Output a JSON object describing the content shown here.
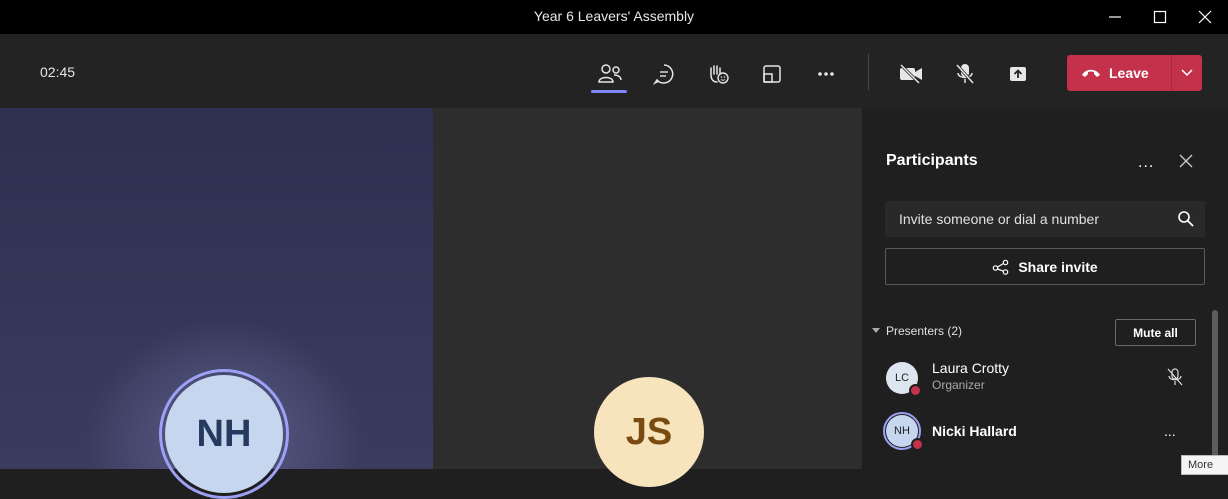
{
  "window": {
    "title": "Year 6 Leavers' Assembly"
  },
  "toolbar": {
    "timer": "02:45",
    "leave_label": "Leave",
    "icons": [
      "people-icon",
      "chat-icon",
      "raise-hand-icon",
      "rooms-icon",
      "more-icon",
      "camera-off-icon",
      "mic-off-icon",
      "share-icon"
    ]
  },
  "tiles": [
    {
      "initials": "NH",
      "color": "#c5d6ee",
      "text_color": "#243a5e"
    },
    {
      "initials": "JS",
      "color": "#f7e4bd",
      "text_color": "#7a4b10"
    }
  ],
  "participants": {
    "title": "Participants",
    "more_label": "...",
    "search_placeholder": "Invite someone or dial a number",
    "share_invite_label": "Share invite",
    "section_label": "Presenters (2)",
    "mute_all_label": "Mute all",
    "people": [
      {
        "initials": "LC",
        "name": "Laura Crotty",
        "role": "Organizer",
        "avatar_color": "#dde6f0"
      },
      {
        "initials": "NH",
        "name": "Nicki Hallard",
        "role": "",
        "avatar_color": "#c5d6ee"
      }
    ],
    "row_more_label": "..."
  },
  "tooltip": {
    "text": "More"
  },
  "colors": {
    "accent": "#7f85f5",
    "leave": "#c4314b"
  }
}
